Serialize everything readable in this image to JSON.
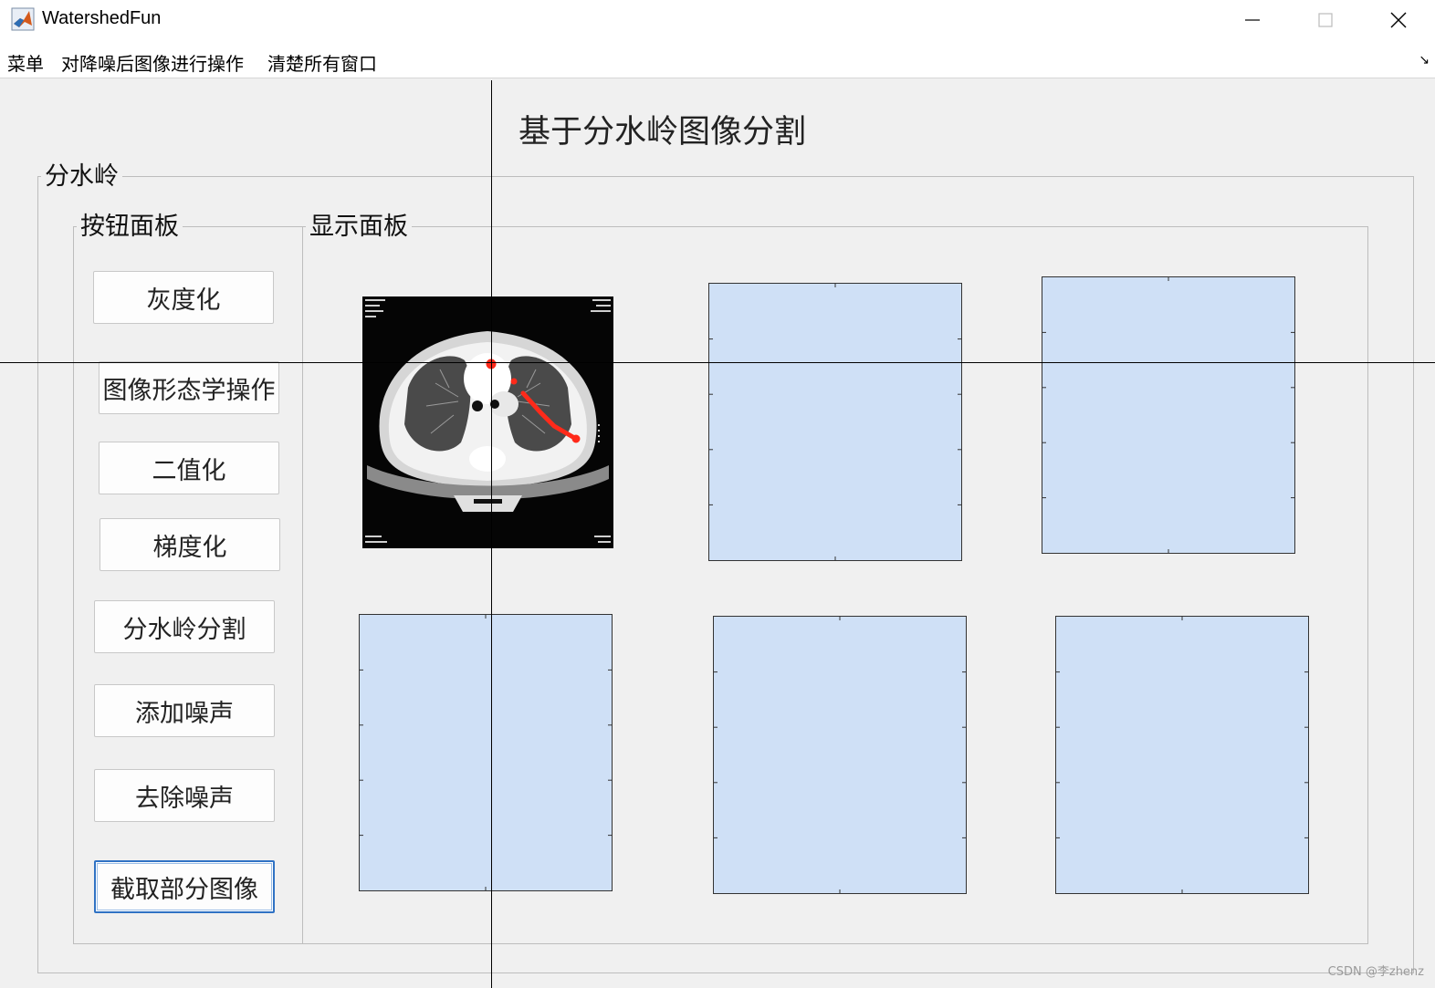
{
  "window": {
    "title": "WatershedFun",
    "controls": [
      "minimize-icon",
      "maximize-icon",
      "close-icon"
    ]
  },
  "menubar": {
    "items": [
      "菜单",
      "对降噪后图像进行操作",
      "清楚所有窗口"
    ]
  },
  "figure": {
    "title": "基于分水岭图像分割"
  },
  "panels": {
    "outer": "分水岭",
    "buttons": "按钮面板",
    "display": "显示面板"
  },
  "buttons": [
    "灰度化",
    "图像形态学操作",
    "二值化",
    "梯度化",
    "分水岭分割",
    "添加噪声",
    "去除噪声",
    "截取部分图像"
  ],
  "colors": {
    "axes_background": "#cfe0f6",
    "focus_border": "#2f72c4",
    "marker": "#ff2a1a"
  },
  "watermark": "CSDN @李zhenz"
}
